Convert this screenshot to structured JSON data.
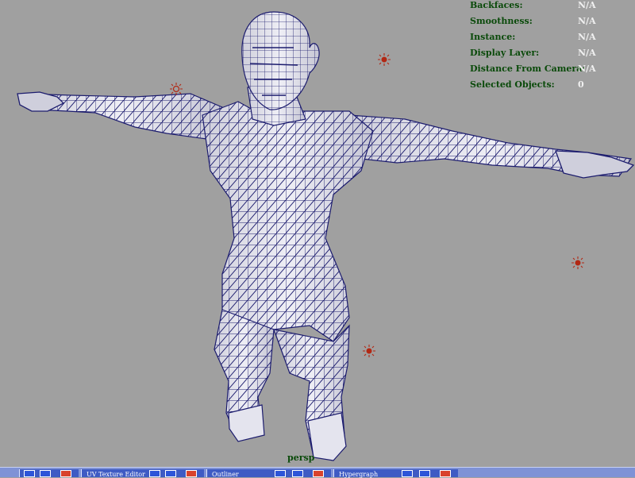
{
  "colors": {
    "background": "#a0a0a0",
    "hud_label": "#0a4a0a",
    "hud_value": "#f0f0f0",
    "wire": "#1c1c6e",
    "mesh_fill": "#e2e2ec",
    "light": "#b22814",
    "taskbar": "#7f92d6"
  },
  "hud": {
    "rows": [
      {
        "label": "Backfaces:",
        "value": "N/A"
      },
      {
        "label": "Smoothness:",
        "value": "N/A"
      },
      {
        "label": "Instance:",
        "value": "N/A"
      },
      {
        "label": "Display Layer:",
        "value": "N/A"
      },
      {
        "label": "Distance From Camera:",
        "value": "N/A"
      },
      {
        "label": "Selected Objects:",
        "value": "0"
      }
    ]
  },
  "viewport": {
    "camera": "persp"
  },
  "taskbar": {
    "windows": [
      {
        "title": "",
        "icons": [
          "restore-icon",
          "minimize-icon",
          "close-icon"
        ]
      },
      {
        "title": "UV Texture Editor",
        "icons": [
          "restore-icon",
          "minimize-icon",
          "close-icon"
        ]
      },
      {
        "title": "Outliner",
        "icons": [
          "restore-icon",
          "minimize-icon",
          "close-icon"
        ]
      },
      {
        "title": "Hypergraph",
        "icons": [
          "restore-icon",
          "minimize-icon",
          "close-icon"
        ]
      }
    ]
  },
  "lights": [
    {
      "type": "point-light-icon",
      "state": "active"
    },
    {
      "type": "point-light-icon",
      "state": "default"
    },
    {
      "type": "point-light-icon",
      "state": "default"
    },
    {
      "type": "point-light-icon",
      "state": "default"
    }
  ]
}
